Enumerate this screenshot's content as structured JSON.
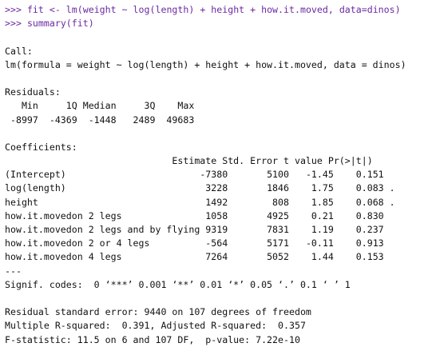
{
  "prompts": [
    {
      "symbol": ">>>",
      "command": "fit <- lm(weight ~ log(length) + height + how.it.moved, data=dinos)"
    },
    {
      "symbol": ">>>",
      "command": "summary(fit)"
    }
  ],
  "call": {
    "heading": "Call:",
    "formula": "lm(formula = weight ~ log(length) + height + how.it.moved, data = dinos)"
  },
  "residuals": {
    "heading": "Residuals:",
    "header": "   Min     1Q Median     3Q    Max ",
    "values": " -8997  -4369  -1448   2489  49683 "
  },
  "coefficients": {
    "heading": "Coefficients:",
    "header": "                              Estimate Std. Error t value Pr(>|t|)  ",
    "rows": [
      {
        "name": "(Intercept)",
        "estimate": "-7380",
        "std_error": "5100",
        "t_value": "-1.45",
        "p_value": "0.151",
        "sig": " "
      },
      {
        "name": "log(length)",
        "estimate": "3228",
        "std_error": "1846",
        "t_value": "1.75",
        "p_value": "0.083",
        "sig": "."
      },
      {
        "name": "height",
        "estimate": "1492",
        "std_error": "808",
        "t_value": "1.85",
        "p_value": "0.068",
        "sig": "."
      },
      {
        "name": "how.it.movedon 2 legs",
        "estimate": "1058",
        "std_error": "4925",
        "t_value": "0.21",
        "p_value": "0.830",
        "sig": " "
      },
      {
        "name": "how.it.movedon 2 legs and by flying",
        "estimate": "9319",
        "std_error": "7831",
        "t_value": "1.19",
        "p_value": "0.237",
        "sig": " "
      },
      {
        "name": "how.it.movedon 2 or 4 legs",
        "estimate": "-564",
        "std_error": "5171",
        "t_value": "-0.11",
        "p_value": "0.913",
        "sig": " "
      },
      {
        "name": "how.it.movedon 4 legs",
        "estimate": "7264",
        "std_error": "5052",
        "t_value": "1.44",
        "p_value": "0.153",
        "sig": " "
      }
    ],
    "separator": "---",
    "signif_codes": "Signif. codes:  0 ‘***’ 0.001 ‘**’ 0.01 ‘*’ 0.05 ‘.’ 0.1 ‘ ’ 1"
  },
  "summary_stats": {
    "residual_se": "Residual standard error: 9440 on 107 degrees of freedom",
    "r_squared": "Multiple R-squared:  0.391, Adjusted R-squared:  0.357",
    "f_statistic": "F-statistic: 11.5 on 6 and 107 DF,  p-value: 7.22e-10"
  },
  "colors": {
    "prompt": "#6b2aa3",
    "output": "#111111",
    "background": "#ffffff"
  }
}
